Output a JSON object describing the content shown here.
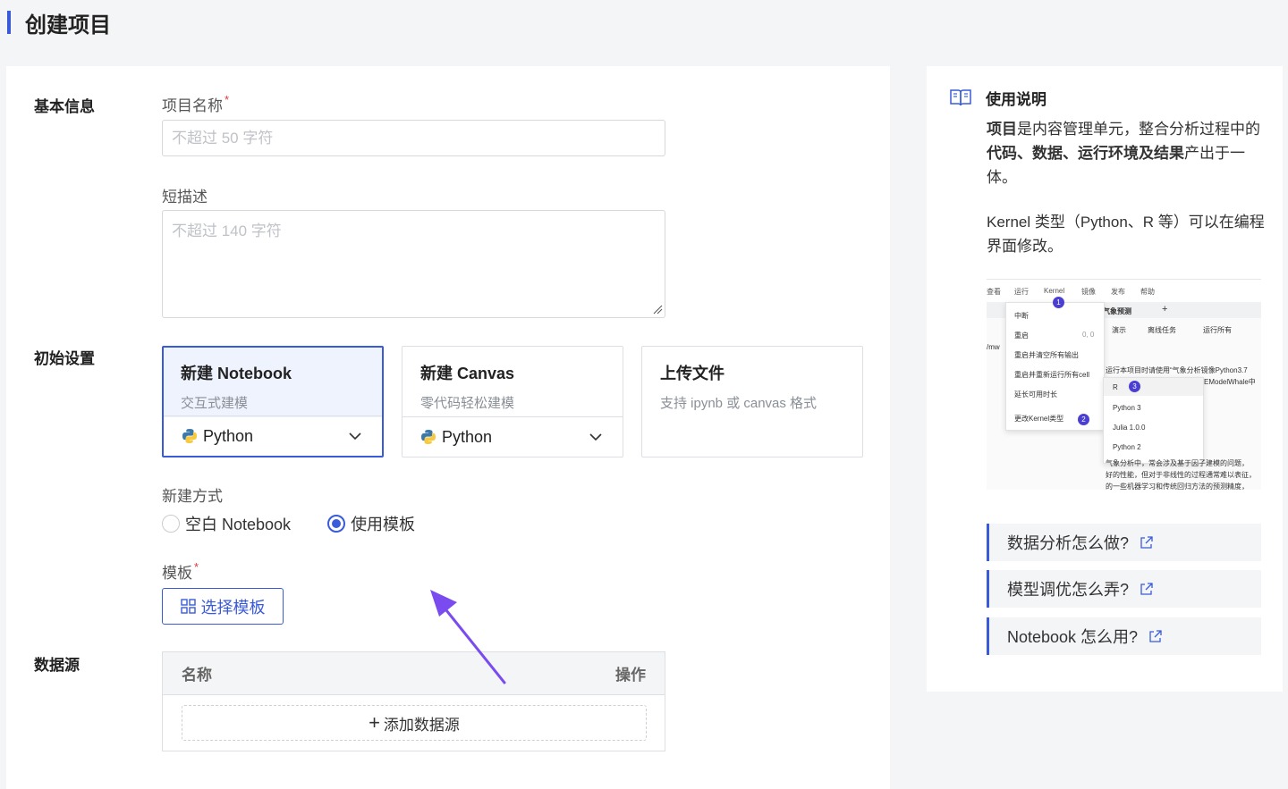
{
  "page": {
    "title": "创建项目"
  },
  "sections": {
    "basic": "基本信息",
    "initial": "初始设置",
    "datasource": "数据源"
  },
  "fields": {
    "name": {
      "label": "项目名称",
      "required_mark": "*",
      "placeholder": "不超过 50 字符",
      "value": ""
    },
    "desc": {
      "label": "短描述",
      "placeholder": "不超过 140 字符",
      "value": ""
    }
  },
  "options": [
    {
      "title": "新建 Notebook",
      "subtitle": "交互式建模",
      "kernel": "Python",
      "selected": true
    },
    {
      "title": "新建 Canvas",
      "subtitle": "零代码轻松建模",
      "kernel": "Python",
      "selected": false
    },
    {
      "title": "上传文件",
      "subtitle": "支持 ipynb 或 canvas 格式",
      "selected": false
    }
  ],
  "create_mode": {
    "label": "新建方式",
    "options": [
      "空白 Notebook",
      "使用模板"
    ],
    "selected": "使用模板"
  },
  "template": {
    "label": "模板",
    "required_mark": "*",
    "button": "选择模板"
  },
  "datasource_table": {
    "columns": [
      "名称",
      "操作"
    ],
    "add_button": "添加数据源"
  },
  "help": {
    "title": "使用说明",
    "para1": {
      "b1": "项目",
      "t1": "是内容管理单元，整合分析过程中的",
      "b2": "代码、数据、运行环境及结果",
      "t2": "产出于一体。"
    },
    "para2": "Kernel 类型（Python、R 等）可以在编程界面修改。",
    "screenshot": {
      "menu": [
        "查看",
        "运行",
        "Kernel",
        "镜像",
        "发布",
        "帮助"
      ],
      "tab": "气象预测",
      "toolbar": [
        "演示",
        "离线任务",
        "运行所有"
      ],
      "kernel_menu": [
        "中断",
        "重启",
        "重启并清空所有输出",
        "重启并重新运行所有cell",
        "延长可用时长",
        "更改Kernel类型"
      ],
      "restart_hint": "0, 0",
      "kernels": [
        "R",
        "Python 3",
        "Julia 1.0.0",
        "Python 2"
      ],
      "badges": [
        "1",
        "2",
        "3"
      ],
      "side_label": "/mw",
      "text_lines": [
        "运行本项目时请使用“气象分析镜像Python3.7",
        "EModelWhale中",
        "气象分析中，常会涉及基于因子建模的问题，",
        "好的性能，但对于非线性的过程通常难以表征，",
        "的一些机器学习和传统回归方法的预测精度，"
      ]
    },
    "links": [
      "数据分析怎么做?",
      "模型调优怎么弄?",
      "Notebook 怎么用?"
    ]
  },
  "colors": {
    "accent": "#3a5bd9",
    "arrow": "#7a4cf0",
    "required": "#e0363c"
  }
}
